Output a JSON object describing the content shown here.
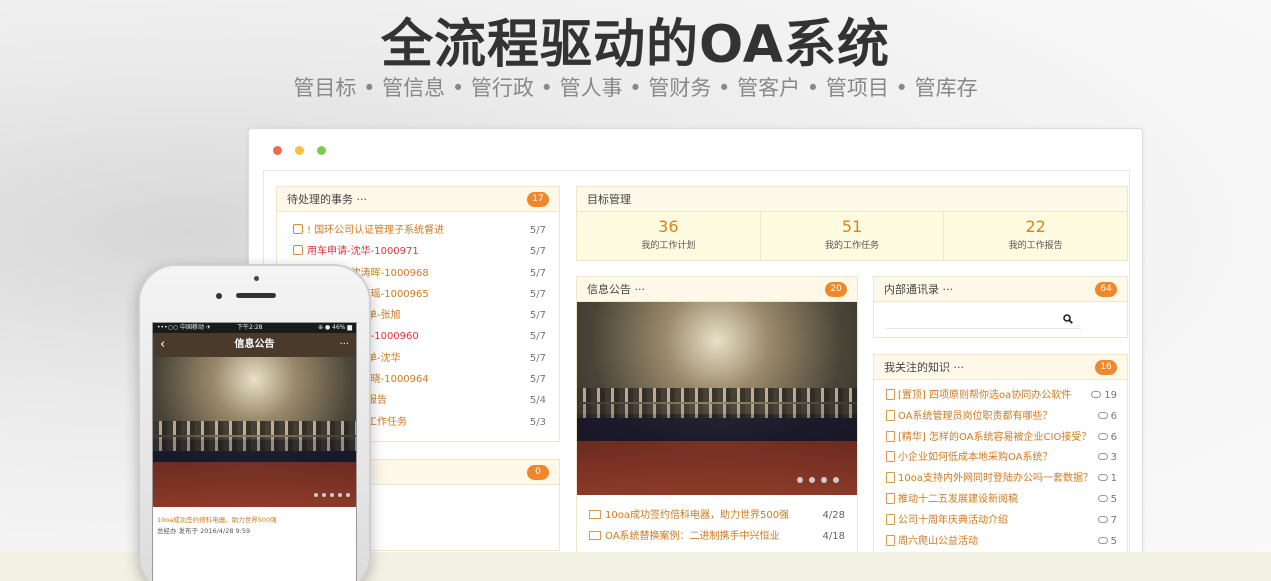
{
  "hero": {
    "title": "全流程驱动的OA系统",
    "subtitle": "管目标 • 管信息 • 管行政 • 管人事 • 管财务 • 管客户 • 管项目 • 管库存"
  },
  "todo": {
    "title": "待处理的事务 ···",
    "count": "17",
    "items": [
      {
        "text": "! 国环公司认证管理子系统督进",
        "date": "5/7",
        "red": false
      },
      {
        "text": "用车申请-沈华-1000971",
        "date": "5/7",
        "red": true
      },
      {
        "text": "用车申请-沈涛晖-1000968",
        "date": "5/7",
        "red": false
      },
      {
        "text": "请假申请-王晓瑶-1000965",
        "date": "5/7",
        "red": false
      },
      {
        "text": "月度绩效考核单-张旭",
        "date": "5/7",
        "red": false
      },
      {
        "text": "费用报销-李朋-1000960",
        "date": "5/7",
        "red": true
      },
      {
        "text": "月度绩效考核单-沈华",
        "date": "5/7",
        "red": false
      },
      {
        "text": "出差申请-李谨晓-1000964",
        "date": "5/7",
        "red": false
      },
      {
        "text": "第二季度工作报告",
        "date": "5/4",
        "red": false
      },
      {
        "text": "完成季度财务工作任务",
        "date": "5/3",
        "red": false
      }
    ]
  },
  "second_panel": {
    "count": "0"
  },
  "goals": {
    "title": "目标管理",
    "items": [
      {
        "num": "36",
        "label": "我的工作计划"
      },
      {
        "num": "51",
        "label": "我的工作任务"
      },
      {
        "num": "22",
        "label": "我的工作报告"
      }
    ]
  },
  "notices": {
    "title": "信息公告 ···",
    "count": "20",
    "items": [
      {
        "text": "10oa成功签约倍科电器，助力世界500强",
        "date": "4/28"
      },
      {
        "text": "OA系统替换案例：二进制携手中兴恒业",
        "date": "4/18"
      }
    ]
  },
  "contacts": {
    "title": "内部通讯录 ···",
    "count": "64",
    "search_placeholder": ""
  },
  "knowledge": {
    "title": "我关注的知识 ···",
    "count": "16",
    "items": [
      {
        "text": "[置顶] 四项原则帮你选oa协同办公软件",
        "count": "19"
      },
      {
        "text": "OA系统管理员岗位职责都有哪些？",
        "count": "6"
      },
      {
        "text": "[精华] 怎样的OA系统容易被企业CIO接受？",
        "count": "6"
      },
      {
        "text": "小企业如何低成本地采购OA系统？",
        "count": "3"
      },
      {
        "text": "10oa支持内外网同时登陆办公吗一套数据？",
        "count": "1"
      },
      {
        "text": "推动十二五发展建设新阅稿",
        "count": "5"
      },
      {
        "text": "公司十周年庆典活动介绍",
        "count": "7"
      },
      {
        "text": "周六爬山公益活动",
        "count": "5"
      }
    ]
  },
  "phone": {
    "carrier": "•••○○ 中国移动 ✈",
    "time": "下午2:28",
    "battery": "⊕ ● 46% ▆",
    "nav_title": "信息公告",
    "back": "‹",
    "more": "···",
    "news_title": "10oa成功签约倍科电器，助力世界500强",
    "news_meta": "总经办 发布于 2016/4/28 9:59"
  }
}
